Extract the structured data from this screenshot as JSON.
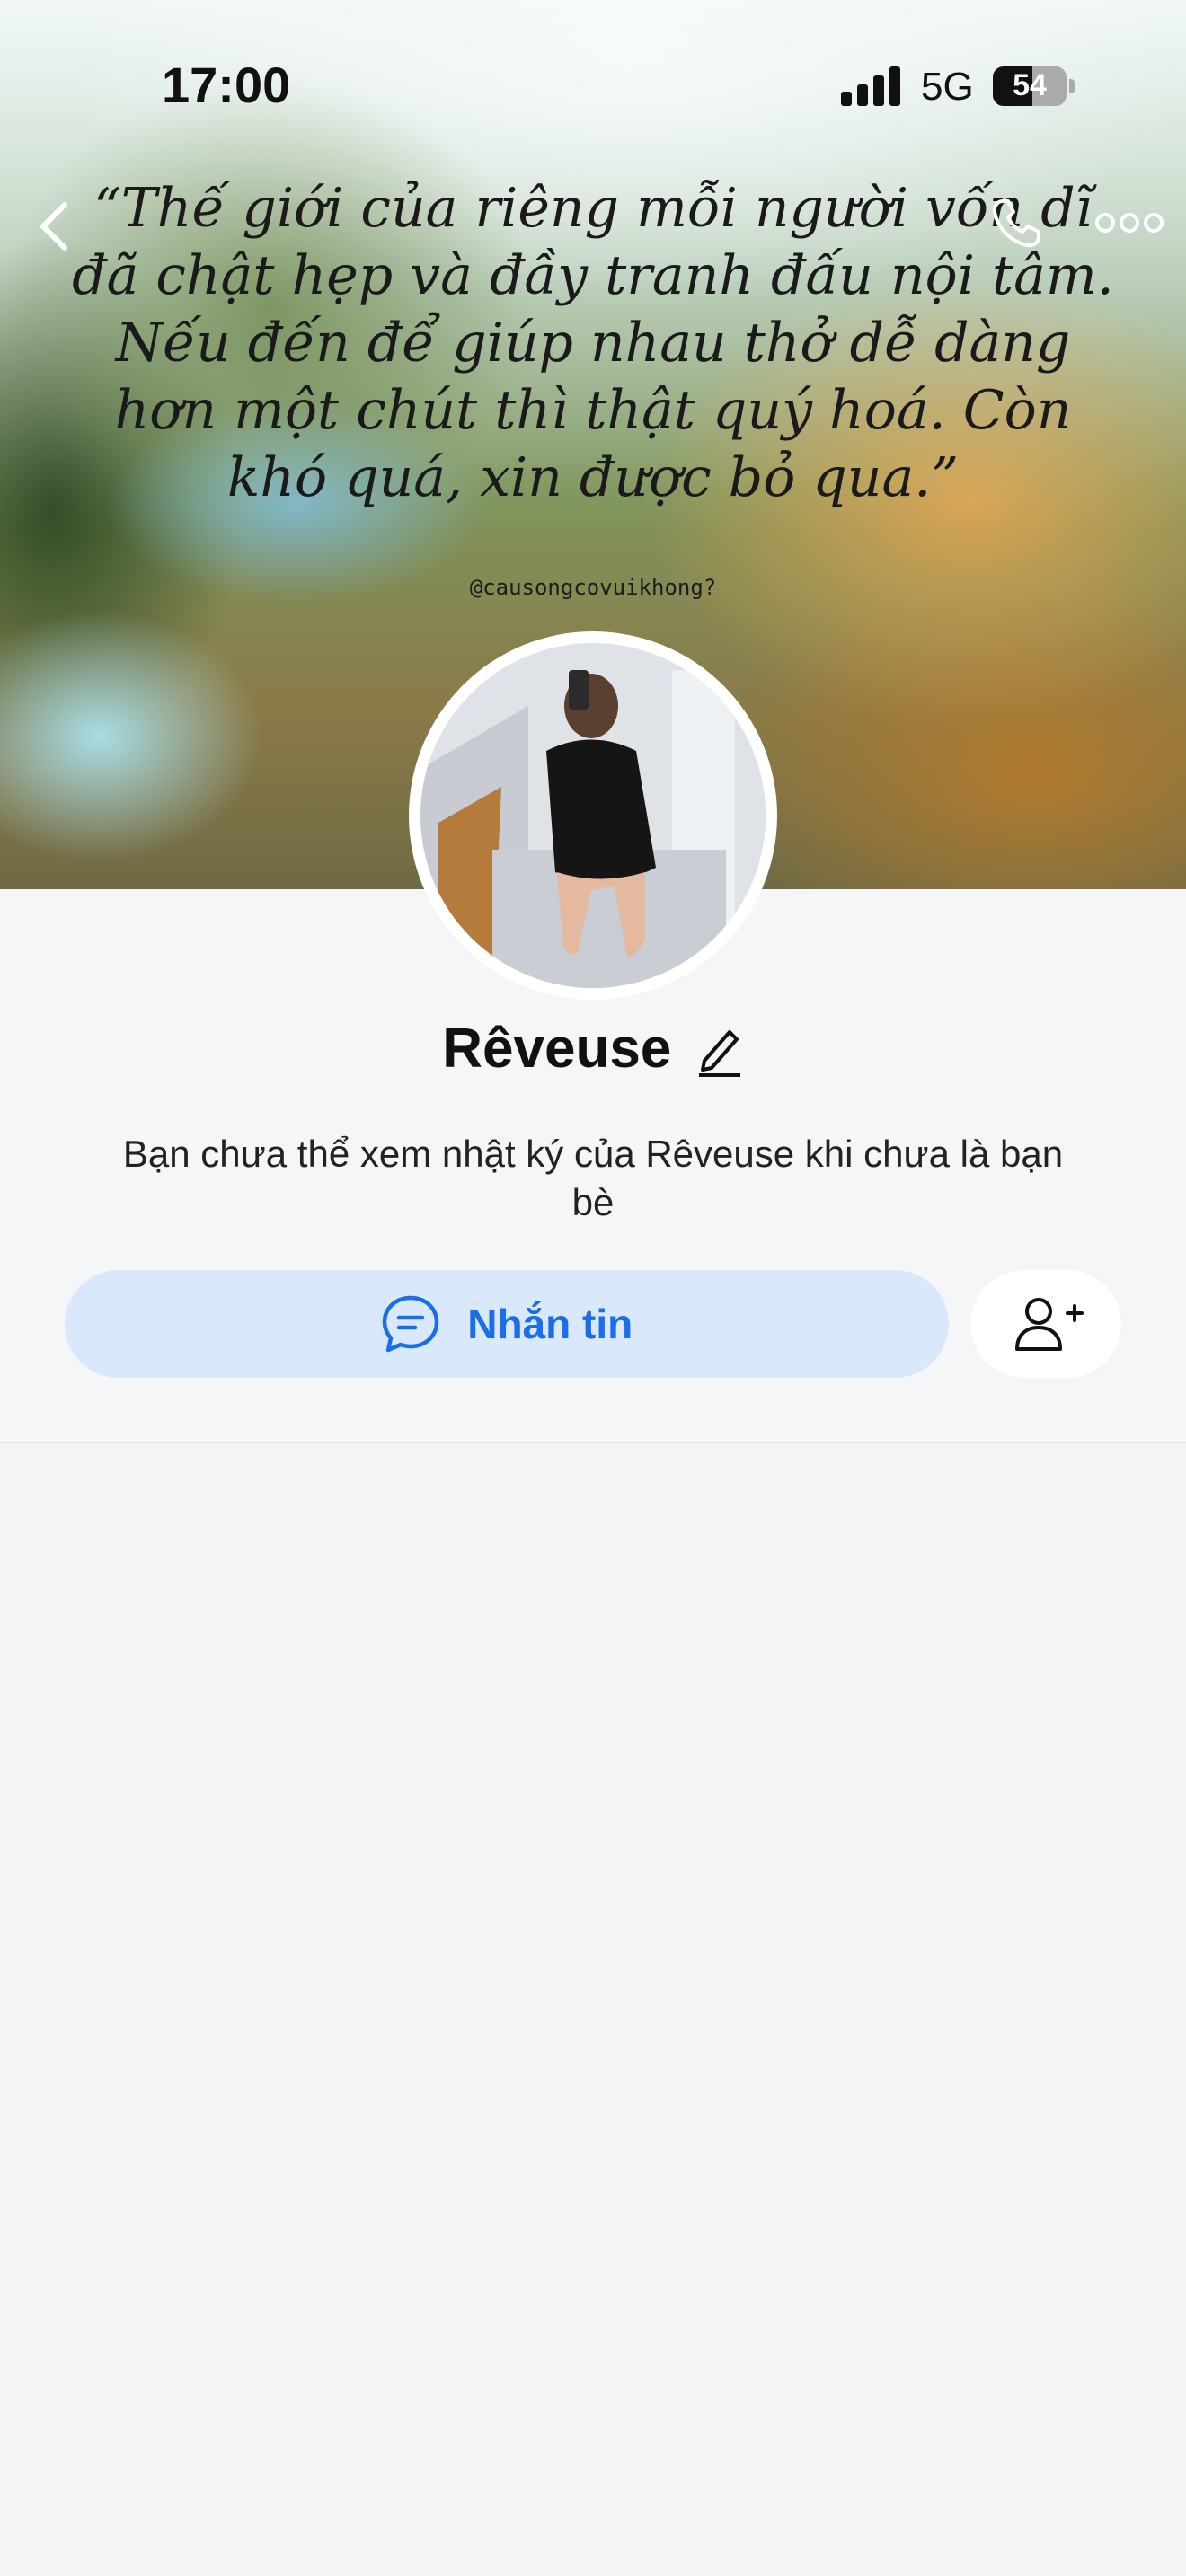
{
  "status_bar": {
    "time": "17:00",
    "network": "5G",
    "battery": "54",
    "battery_level": 0.54
  },
  "cover": {
    "quote": "“Thế giới của riêng mỗi người vốn dĩ đã chật hẹp và đầy tranh đấu nội tâm. Nếu đến để giúp nhau thở dễ dàng hơn một chút thì thật quý hoá. Còn khó quá, xin được bỏ qua.”",
    "handle": "@causongcovuikhong?"
  },
  "profile": {
    "name": "Rêveuse",
    "notice": "Bạn chưa thể xem nhật ký của Rêveuse khi chưa là bạn bè"
  },
  "actions": {
    "message_label": "Nhắn tin",
    "message_icon": "chat-bubble-icon",
    "add_friend_icon": "add-user-icon"
  },
  "icons": {
    "back": "chevron-left-icon",
    "call": "phone-icon",
    "more": "more-dots-icon",
    "edit": "pencil-icon"
  },
  "colors": {
    "accent": "#1a6ee8",
    "message_button_bg": "#dae8fc",
    "page_bg": "#f3f4f6"
  }
}
